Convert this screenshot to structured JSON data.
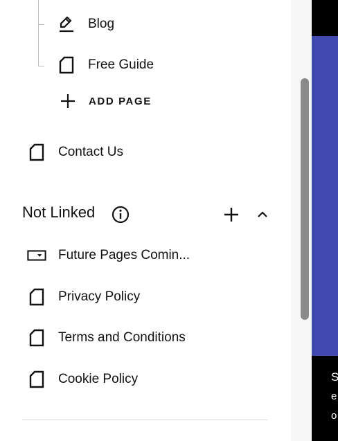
{
  "pages_tree": {
    "blog_label": "Blog",
    "free_guide_label": "Free Guide",
    "add_page_label": "ADD PAGE",
    "contact_label": "Contact Us"
  },
  "not_linked": {
    "title": "Not Linked",
    "items": [
      {
        "label": "Future Pages Comin...",
        "icon": "folder-dropdown-icon"
      },
      {
        "label": "Privacy Policy",
        "icon": "page-icon"
      },
      {
        "label": "Terms and Conditions",
        "icon": "page-icon"
      },
      {
        "label": "Cookie Policy",
        "icon": "page-icon"
      }
    ]
  },
  "preview": {
    "line1": "S",
    "line2": "e",
    "line3": "o"
  },
  "colors": {
    "hero": "#4049ae",
    "scrollbar_thumb": "#8a8a8a"
  }
}
